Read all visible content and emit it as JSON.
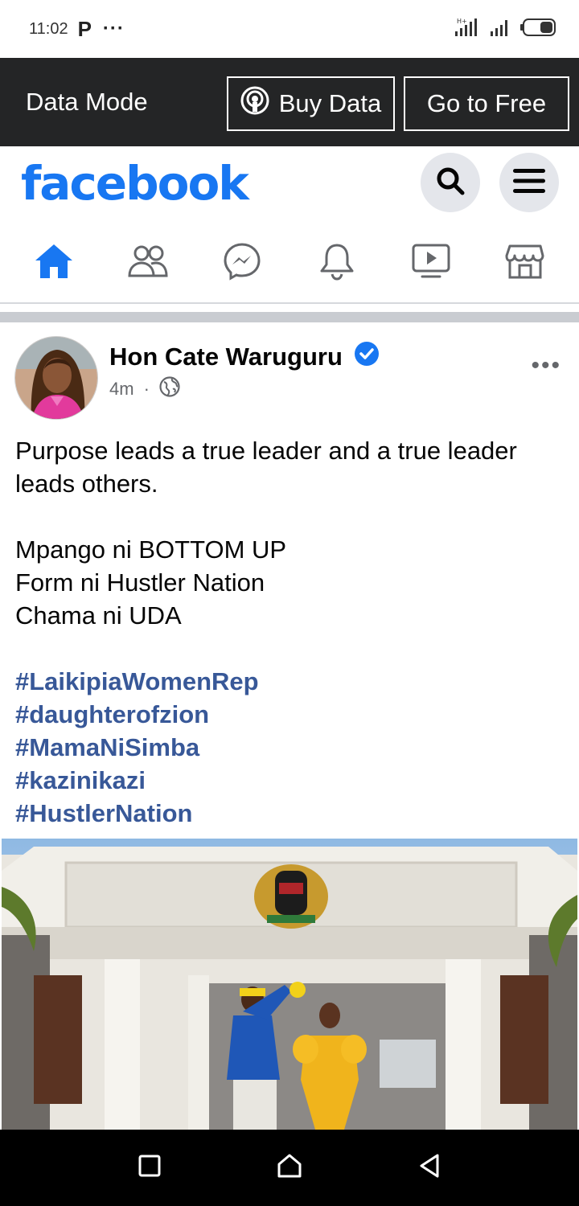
{
  "status_bar": {
    "time": "11:02",
    "app_letter": "P",
    "more": "···",
    "network": "H+"
  },
  "data_mode": {
    "label": "Data Mode",
    "buy_data": "Buy Data",
    "go_free": "Go to Free"
  },
  "header": {
    "logo": "facebook",
    "brand_color": "#1877f2"
  },
  "nav_tabs": [
    {
      "icon": "home-icon",
      "active": true
    },
    {
      "icon": "friends-icon",
      "active": false
    },
    {
      "icon": "messenger-icon",
      "active": false
    },
    {
      "icon": "bell-icon",
      "active": false
    },
    {
      "icon": "video-icon",
      "active": false
    },
    {
      "icon": "marketplace-icon",
      "active": false
    }
  ],
  "post": {
    "author": "Hon Cate Waruguru",
    "verified": true,
    "time": "4m",
    "separator": "·",
    "more": "•••",
    "text_lines": [
      "Purpose leads a true leader and a true leader",
      "leads others.",
      "",
      "Mpango ni BOTTOM UP",
      "Form ni Hustler Nation",
      "Chama ni UDA",
      ""
    ],
    "hashtags": [
      "#LaikipiaWomenRep",
      "#daughterofzion",
      "#MamaNiSimba",
      "#kazinikazi",
      "#HustlerNation"
    ],
    "hashtag_color": "#385898"
  }
}
